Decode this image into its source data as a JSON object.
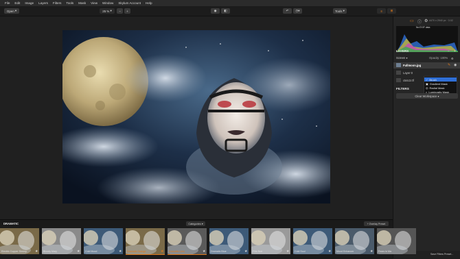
{
  "menu": [
    "File",
    "Edit",
    "Image",
    "Layers",
    "Filters",
    "Tools",
    "Mask",
    "View",
    "Window",
    "Skylum Account",
    "Help"
  ],
  "toolbar": {
    "open": "Open",
    "zoom": "25 %",
    "zoom_out": "−",
    "zoom_in": "+",
    "tools": "Tools"
  },
  "panel": {
    "info": "4470 x 2940 px · 3.02",
    "exif": "No EXIF data",
    "layers_title": "LAYERS",
    "blend_mode": "Screen",
    "opacity_label": "Opacity: 100%",
    "layer_name": "Fullmoon.jpg",
    "layer0": "Layer 0",
    "layer1": "c54c3.0f",
    "filters_title": "FILTERS",
    "clear_workspace": "Clear Workspace",
    "save_preset": "Save Filters Preset..."
  },
  "mask_menu": [
    "Brush",
    "Gradient Mask",
    "Radial Mask",
    "Luminosity Mask"
  ],
  "strip": {
    "title": "DRAMATIC",
    "categories": "Categories",
    "overlay": "+ Overlay Preset",
    "items": [
      "Electric Copper Shrimp",
      "Bloody Mary",
      "Cold Mood",
      "Dramatic Orange",
      "Dramatic Lime",
      "Dramatic Blue",
      "Film Noir",
      "Cold Soul",
      "Mood Enhancer",
      "Fears in Ma"
    ]
  },
  "colors": {
    "accent": "#2f6fd6",
    "highlight": "#e07a1b"
  }
}
